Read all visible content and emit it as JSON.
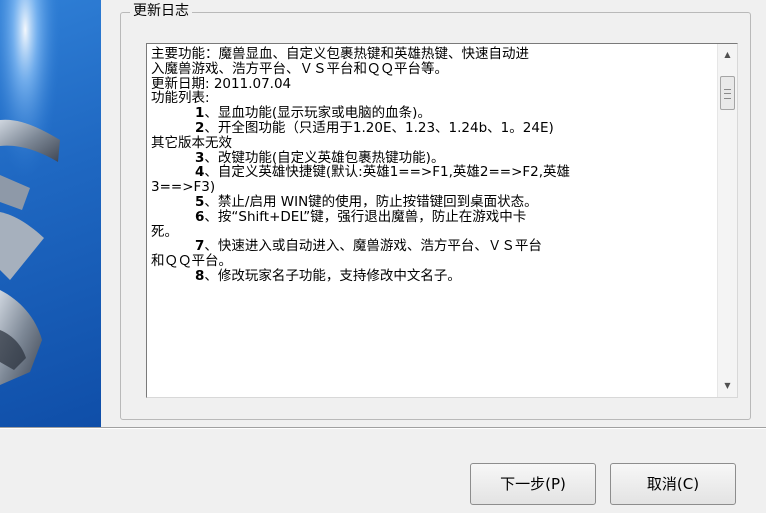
{
  "group": {
    "title": "更新日志"
  },
  "changelog": {
    "lines": [
      "主要功能：魔兽显血、自定义包裹热键和英雄热键、快速自动进",
      "入魔兽游戏、浩方平台、ＶＳ平台和ＱＱ平台等。",
      "更新日期: 2011.07.04",
      "功能列表:"
    ],
    "items": [
      {
        "num": "1",
        "text": "、显血功能(显示玩家或电脑的血条)。"
      },
      {
        "num": "2",
        "text": "、开全图功能（只适用于1.20E、1.23、1.24b、1。24E)"
      },
      {
        "cont": "其它版本无效"
      },
      {
        "num": "3",
        "text": "、改键功能(自定义英雄包裹热键功能)。"
      },
      {
        "num": "4",
        "text": "、自定义英雄快捷键(默认:英雄1==>F1,英雄2==>F2,英雄"
      },
      {
        "cont": "3==>F3)"
      },
      {
        "num": "5",
        "text": "、禁止/启用  WIN键的使用，防止按错键回到桌面状态。"
      },
      {
        "num": "6",
        "text": "、按“Shift+DEL”键，强行退出魔兽，防止在游戏中卡"
      },
      {
        "cont": "死。"
      },
      {
        "num": "7",
        "text": "、快速进入或自动进入、魔兽游戏、浩方平台、ＶＳ平台"
      },
      {
        "cont": "和ＱＱ平台。"
      },
      {
        "num": "8",
        "text": "、修改玩家名子功能，支持修改中文名子。"
      }
    ]
  },
  "buttons": {
    "next": "下一步(P)",
    "cancel": "取消(C)"
  },
  "colors": {
    "banner": "#1f68c2",
    "background": "#f0f0f0"
  },
  "icons": {
    "scroll_up": "arrow-up-icon",
    "scroll_down": "arrow-down-icon"
  }
}
